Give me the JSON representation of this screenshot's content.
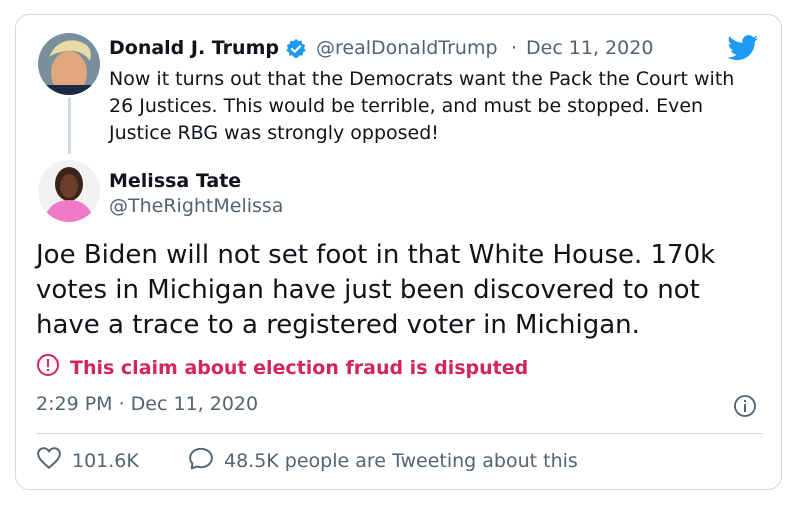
{
  "quoted_tweet": {
    "author_name": "Donald J. Trump",
    "handle": "@realDonaldTrump",
    "separator": "·",
    "date": "Dec 11, 2020",
    "text": "Now it turns out that the Democrats want the Pack the Court with 26 Justices. This would be terrible, and must be stopped. Even Justice RBG was strongly opposed!"
  },
  "tweet": {
    "author_name": "Melissa Tate",
    "handle": "@TheRightMelissa",
    "text": "Joe Biden will not set foot in that White House. 170k votes in Michigan have just been discovered to not have a trace to a registered voter in Michigan.",
    "warning": "This claim about election fraud is disputed",
    "time": "2:29 PM · Dec 11, 2020"
  },
  "footer": {
    "likes": "101.6K",
    "replies_text": "48.5K people are Tweeting about this"
  },
  "colors": {
    "twitter_blue": "#1d9bf0",
    "dispute_red": "#d4245c",
    "muted": "#536471"
  },
  "icons": {
    "logo": "twitter-bird-icon",
    "verified": "verified-badge-icon",
    "warning": "exclamation-circle-icon",
    "info": "info-icon",
    "like": "heart-icon",
    "reply": "speech-bubble-icon"
  }
}
